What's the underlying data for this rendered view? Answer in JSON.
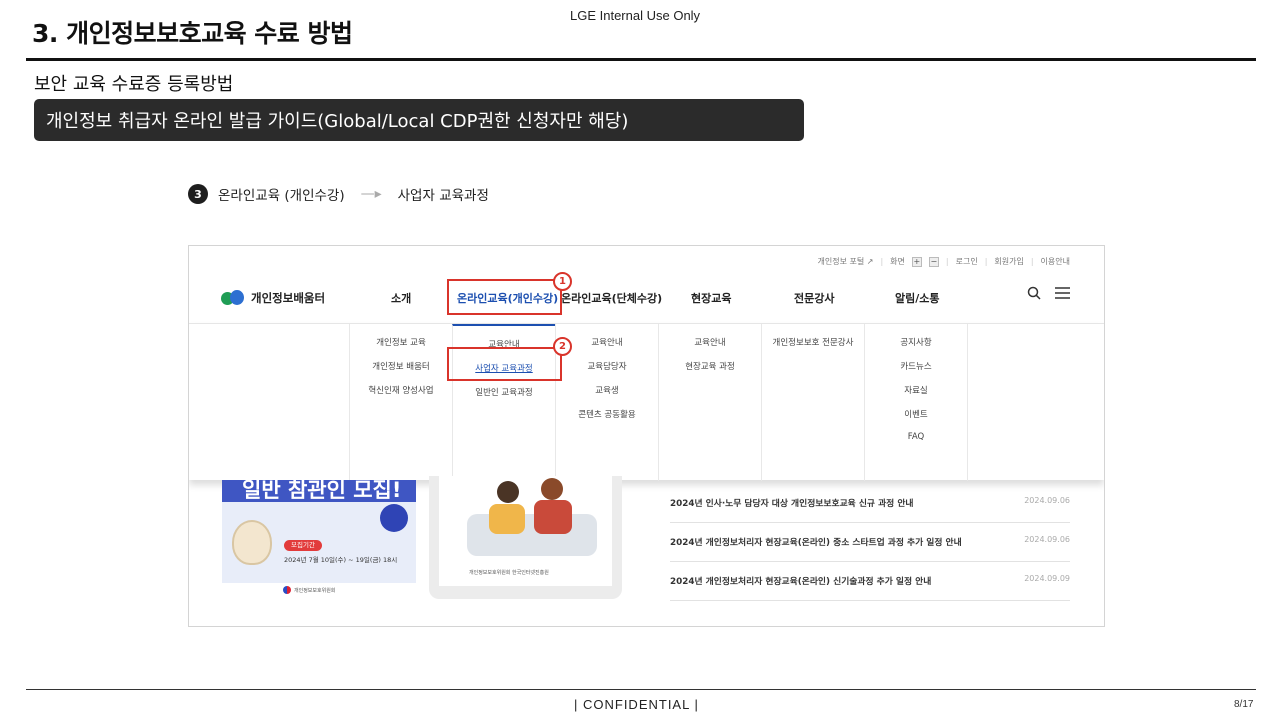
{
  "slide": {
    "title": "3. 개인정보보호교육 수료 방법",
    "internal_label": "LGE Internal Use Only",
    "subtitle": "보안 교육 수료증 등록방법",
    "guide_banner": "개인정보 취급자 온라인 발급 가이드(Global/Local CDP권한 신청자만 해당)"
  },
  "step": {
    "number": "3",
    "current": "온라인교육 (개인수강)",
    "arrow": "—▸",
    "next": "사업자 교육과정"
  },
  "site": {
    "utility_links": [
      "개인정보 포털 ↗",
      "화면",
      "+",
      "−",
      "로그인",
      "회원가입",
      "이용안내"
    ],
    "logo_text": "개인정보배움터",
    "gnb": [
      {
        "label": "소개"
      },
      {
        "label": "온라인교육(개인수강)"
      },
      {
        "label": "온라인교육(단체수강)"
      },
      {
        "label": "현장교육"
      },
      {
        "label": "전문강사"
      },
      {
        "label": "알림/소통"
      }
    ],
    "search_icon": "search-icon",
    "menu_icon": "hamburger-menu-icon",
    "mega_menu": {
      "col1": [
        "개인정보 교육",
        "개인정보 배움터",
        "혁신인재 양성사업"
      ],
      "col2": [
        "교육안내",
        "사업자 교육과정",
        "일반인 교육과정"
      ],
      "col3": [
        "교육안내",
        "교육담당자",
        "교육생",
        "콘텐츠 공동활용"
      ],
      "col4": [
        "교육안내",
        "현장교육 과정"
      ],
      "col5": [
        "개인정보보호 전문강사"
      ],
      "col6": [
        "공지사항",
        "카드뉴스",
        "자료실",
        "이벤트",
        "FAQ"
      ]
    },
    "callouts": [
      "1",
      "2"
    ],
    "banner_left": {
      "headline": "일반 참관인 모집!",
      "tag": "모집기간",
      "period": "2024년 7월 10일(수) ~ 19일(금) 18시",
      "org": "개인정보보호위원회"
    },
    "banner_mid": {
      "orgs": "개인정보보호위원회   한국인터넷진흥원"
    },
    "news": [
      {
        "title": "2024년 인사·노무 담당자 대상 개인정보보호교육 신규 과정 안내",
        "date": "2024.09.06"
      },
      {
        "title": "2024년 개인정보처리자 현장교육(온라인) 중소 스타트업 과정 추가 일정 안내",
        "date": "2024.09.06"
      },
      {
        "title": "2024년 개인정보처리자 현장교육(온라인) 신기술과정 추가 일정 안내",
        "date": "2024.09.09"
      }
    ]
  },
  "footer": {
    "confidential": "| CONFIDENTIAL |",
    "page": "8/17"
  },
  "colors": {
    "accent_blue": "#1c4fb0",
    "callout_red": "#d9342b",
    "banner_dark": "#2b2b2b"
  }
}
